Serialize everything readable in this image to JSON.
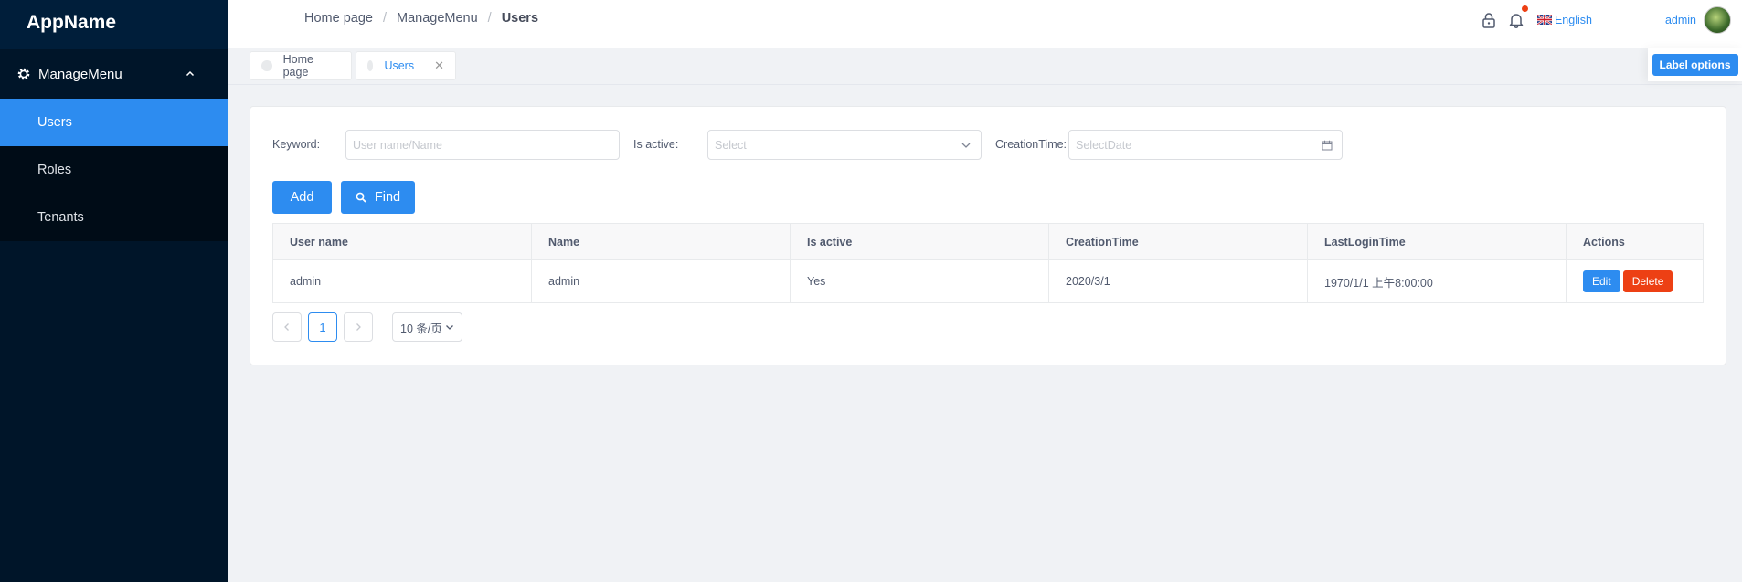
{
  "sidebar": {
    "app_name": "AppName",
    "group_label": "ManageMenu",
    "items": [
      {
        "label": "Users"
      },
      {
        "label": "Roles"
      },
      {
        "label": "Tenants"
      }
    ]
  },
  "header": {
    "breadcrumb": [
      "Home page",
      "ManageMenu",
      "Users"
    ],
    "language": "English",
    "user": "admin"
  },
  "tags": {
    "items": [
      {
        "label": "Home page"
      },
      {
        "label": "Users"
      }
    ],
    "label_options": "Label options"
  },
  "filters": {
    "keyword_label": "Keyword:",
    "keyword_placeholder": "User name/Name",
    "active_label": "Is active:",
    "active_placeholder": "Select",
    "creation_label": "CreationTime:",
    "creation_placeholder": "SelectDate"
  },
  "buttons": {
    "add": "Add",
    "find": "Find"
  },
  "table": {
    "columns": [
      "User name",
      "Name",
      "Is active",
      "CreationTime",
      "LastLoginTime",
      "Actions"
    ],
    "rows": [
      {
        "user_name": "admin",
        "name": "admin",
        "is_active": "Yes",
        "creation_time": "2020/3/1",
        "last_login": "1970/1/1 上午8:00:00",
        "edit": "Edit",
        "delete": "Delete"
      }
    ]
  },
  "pagination": {
    "current_page": "1",
    "page_size": "10 条/页"
  },
  "colors": {
    "primary": "#2d8cf0",
    "danger": "#ed4014",
    "sidebar_bg": "#001529"
  }
}
